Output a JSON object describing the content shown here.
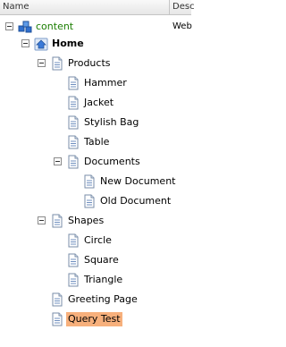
{
  "columns": {
    "name": "Name",
    "description": "Desc"
  },
  "rows": {
    "content": {
      "label": "content",
      "description": "Web"
    },
    "home": {
      "label": "Home"
    },
    "products": {
      "label": "Products"
    },
    "hammer": {
      "label": "Hammer"
    },
    "jacket": {
      "label": "Jacket"
    },
    "stylish_bag": {
      "label": "Stylish Bag"
    },
    "table": {
      "label": "Table"
    },
    "documents": {
      "label": "Documents"
    },
    "new_document": {
      "label": "New Document"
    },
    "old_document": {
      "label": "Old Document"
    },
    "shapes": {
      "label": "Shapes"
    },
    "circle": {
      "label": "Circle"
    },
    "square": {
      "label": "Square"
    },
    "triangle": {
      "label": "Triangle"
    },
    "greeting_page": {
      "label": "Greeting Page"
    },
    "query_test": {
      "label": "Query Test"
    }
  },
  "colors": {
    "selection": "#f7b07c",
    "root_label": "#1a7d00"
  }
}
